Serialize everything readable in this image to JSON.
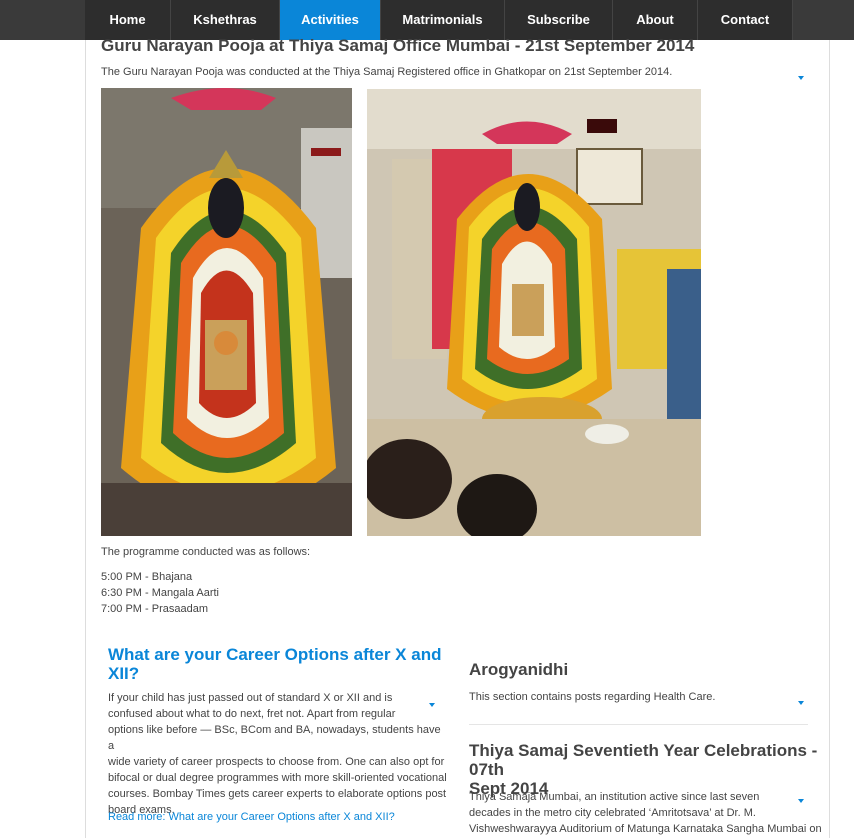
{
  "nav": {
    "items": [
      {
        "label": "Home",
        "active": false
      },
      {
        "label": "Kshethras",
        "active": false
      },
      {
        "label": "Activities",
        "active": true
      },
      {
        "label": "Matrimonials",
        "active": false
      },
      {
        "label": "Subscribe",
        "active": false
      },
      {
        "label": "About",
        "active": false
      },
      {
        "label": "Contact",
        "active": false
      }
    ],
    "accent_color": "#0a86d8"
  },
  "post": {
    "title": "Guru Narayan Pooja at Thiya Samaj Office Mumbai - 21st September 2014",
    "intro": "The Guru Narayan Pooja was conducted at the Thiya Samaj Registered office in Ghatkopar on 21st September 2014.",
    "schedule_intro": "The programme conducted was as follows:",
    "schedule": [
      "5:00 PM - Bhajana",
      "6:30 PM - Mangala Aarti",
      "7:00 PM - Prasaadam"
    ]
  },
  "career": {
    "title_line1": "What are your Career Options after X and",
    "title_line2": "XII?",
    "body": [
      "If your child has just passed out of standard X or XII and is",
      "confused about what to do next, fret not. Apart from regular",
      "options like before — BSc, BCom and BA, nowadays, students have a",
      "wide variety of career prospects to choose from. One can also opt for",
      "bifocal or dual degree programmes with more skill-oriented vocational",
      "courses. Bombay Times gets career experts to elaborate options post",
      "board exams."
    ],
    "read_more": "Read more: What are your Career Options after X and XII?"
  },
  "arogyanidhi": {
    "title": "Arogyanidhi",
    "body": "This section contains posts regarding Health Care."
  },
  "celebrations": {
    "title_line1": "Thiya Samaj Seventieth Year Celebrations - 07th",
    "title_line2": "Sept 2014",
    "body": [
      "Thiya Samaja Mumbai, an institution active since last seven",
      "decades in the metro city celebrated ‘Amritotsava’ at Dr. M.",
      "Vishweshwarayya Auditorium of Matunga Karnataka Sangha Mumbai on"
    ]
  }
}
